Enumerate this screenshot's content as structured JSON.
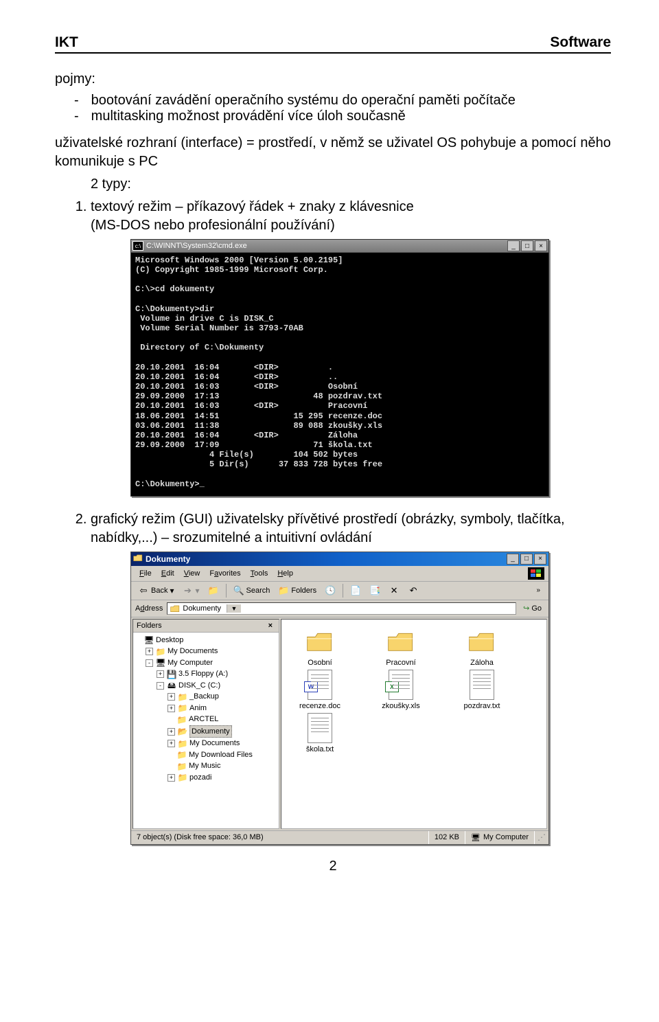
{
  "header": {
    "left": "IKT",
    "right": "Software"
  },
  "intro": {
    "pojmy_label": "pojmy:",
    "bullets": [
      "bootování zavádění operačního systému do operační paměti počítače",
      "multitasking možnost provádění více úloh současně"
    ],
    "para2a": "uživatelské rozhraní (interface) = prostředí, v němž se uživatel OS pohybuje a pomocí něho komunikuje s PC",
    "para2b": "2 typy:",
    "item1_a": "textový režim – příkazový řádek + znaky z klávesnice",
    "item1_b": "(MS-DOS nebo profesionální používání)",
    "item2": "grafický režim (GUI) uživatelsky přívětivé prostředí (obrázky, symboly, tlačítka, nabídky,...) – srozumitelné a intuitivní ovládání"
  },
  "cmd": {
    "title": "C:\\WINNT\\System32\\cmd.exe",
    "lines": "Microsoft Windows 2000 [Version 5.00.2195]\n(C) Copyright 1985-1999 Microsoft Corp.\n\nC:\\>cd dokumenty\n\nC:\\Dokumenty>dir\n Volume in drive C is DISK_C\n Volume Serial Number is 3793-70AB\n\n Directory of C:\\Dokumenty\n\n20.10.2001  16:04       <DIR>          .\n20.10.2001  16:04       <DIR>          ..\n20.10.2001  16:03       <DIR>          Osobní\n29.09.2000  17:13                   48 pozdrav.txt\n20.10.2001  16:03       <DIR>          Pracovní\n18.06.2001  14:51               15 295 recenze.doc\n03.06.2001  11:38               89 088 zkoušky.xls\n20.10.2001  16:04       <DIR>          Záloha\n29.09.2000  17:09                   71 škola.txt\n               4 File(s)        104 502 bytes\n               5 Dir(s)      37 833 728 bytes free\n\nC:\\Dokumenty>_"
  },
  "explorer": {
    "title": "Dokumenty",
    "menu": [
      "File",
      "Edit",
      "View",
      "Favorites",
      "Tools",
      "Help"
    ],
    "toolbar": {
      "back": "Back",
      "search": "Search",
      "folders": "Folders"
    },
    "address_label": "Address",
    "address_value": "Dokumenty",
    "go_label": "Go",
    "folders_label": "Folders",
    "tree": [
      {
        "depth": 0,
        "pm": "",
        "ico": "desktop",
        "label": "Desktop"
      },
      {
        "depth": 1,
        "pm": "+",
        "ico": "folder",
        "label": "My Documents"
      },
      {
        "depth": 1,
        "pm": "-",
        "ico": "computer",
        "label": "My Computer"
      },
      {
        "depth": 2,
        "pm": "+",
        "ico": "floppy",
        "label": "3.5 Floppy (A:)"
      },
      {
        "depth": 2,
        "pm": "-",
        "ico": "drive",
        "label": "DISK_C (C:)"
      },
      {
        "depth": 3,
        "pm": "+",
        "ico": "folder",
        "label": "_Backup"
      },
      {
        "depth": 3,
        "pm": "+",
        "ico": "folder",
        "label": "Anim"
      },
      {
        "depth": 3,
        "pm": "",
        "ico": "folder",
        "label": "ARCTEL"
      },
      {
        "depth": 3,
        "pm": "+",
        "ico": "folder-open",
        "label": "Dokumenty",
        "selected": true
      },
      {
        "depth": 3,
        "pm": "+",
        "ico": "folder",
        "label": "My Documents"
      },
      {
        "depth": 3,
        "pm": "",
        "ico": "folder",
        "label": "My Download Files"
      },
      {
        "depth": 3,
        "pm": "",
        "ico": "folder",
        "label": "My Music"
      },
      {
        "depth": 3,
        "pm": "+",
        "ico": "folder",
        "label": "pozadi"
      }
    ],
    "files": [
      {
        "type": "folder",
        "label": "Osobní"
      },
      {
        "type": "folder",
        "label": "Pracovní"
      },
      {
        "type": "folder",
        "label": "Záloha"
      },
      {
        "type": "word",
        "label": "recenze.doc"
      },
      {
        "type": "excel",
        "label": "zkoušky.xls"
      },
      {
        "type": "text",
        "label": "pozdrav.txt"
      },
      {
        "type": "text",
        "label": "škola.txt"
      }
    ],
    "status": {
      "left": "7 object(s) (Disk free space: 36,0 MB)",
      "mid": "102 KB",
      "right": "My Computer"
    }
  },
  "page_number": "2"
}
